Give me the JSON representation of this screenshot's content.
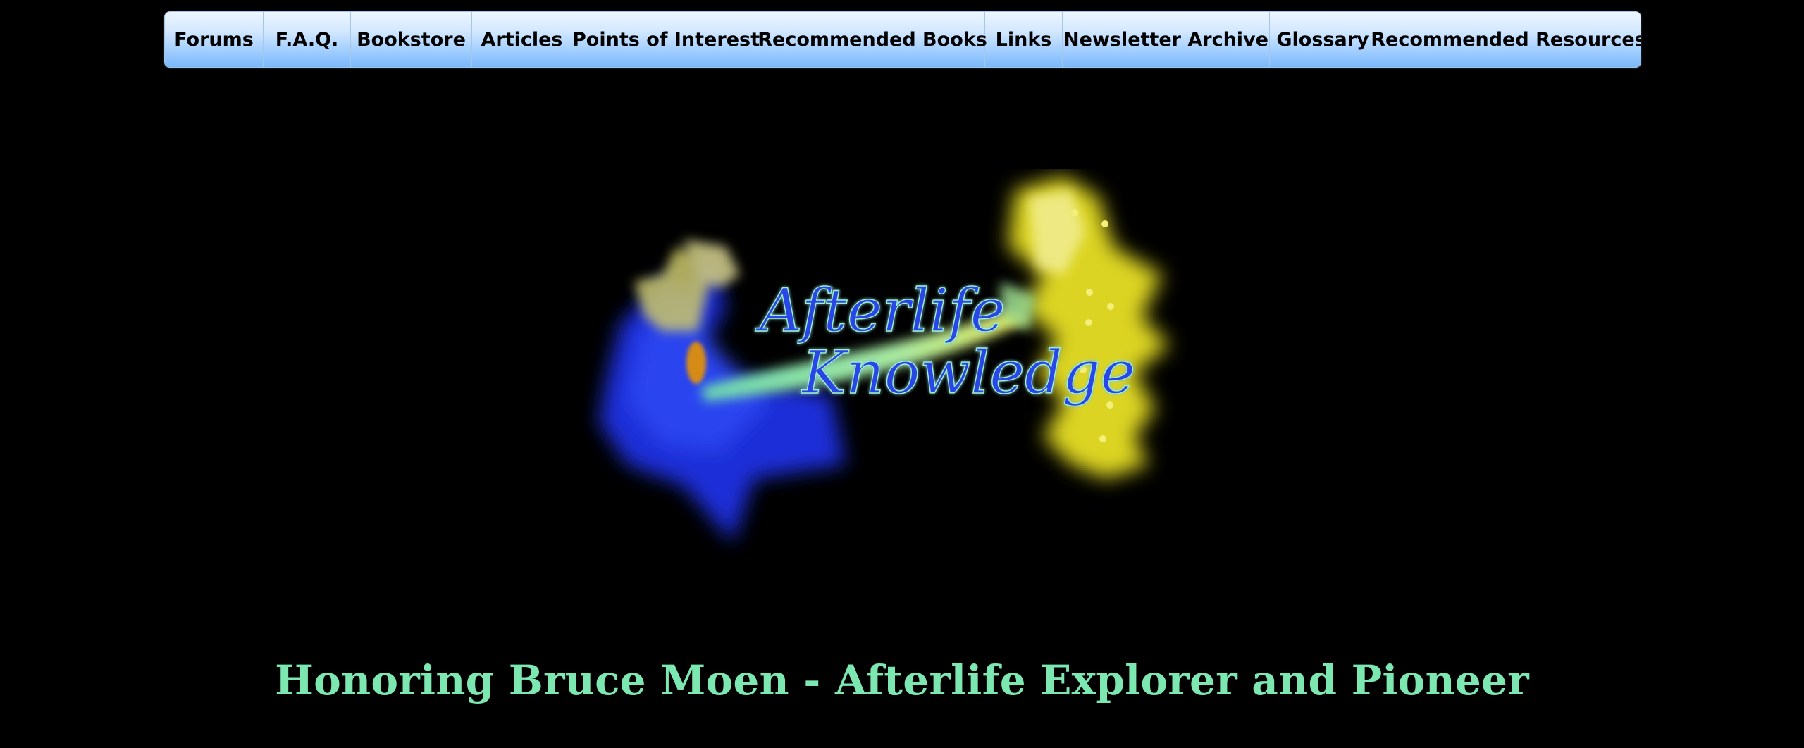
{
  "nav": {
    "items": [
      {
        "label": "Forums"
      },
      {
        "label": "F.A.Q."
      },
      {
        "label": "Bookstore"
      },
      {
        "label": "Articles"
      },
      {
        "label": "Points of Interest"
      },
      {
        "label": "Recommended Books"
      },
      {
        "label": "Links"
      },
      {
        "label": "Newsletter Archive"
      },
      {
        "label": "Glossary"
      },
      {
        "label": "Recommended Resources"
      }
    ]
  },
  "logo": {
    "line1": "Afterlife",
    "line2": "Knowledge"
  },
  "main": {
    "title": "Honoring Bruce Moen - Afterlife Explorer and Pioneer"
  },
  "colors": {
    "background": "#000000",
    "title": "#7ce7b1",
    "logo_text": "#2b45e8",
    "logo_blue": "#1a2fd8",
    "logo_yellow": "#e3dc2a"
  }
}
